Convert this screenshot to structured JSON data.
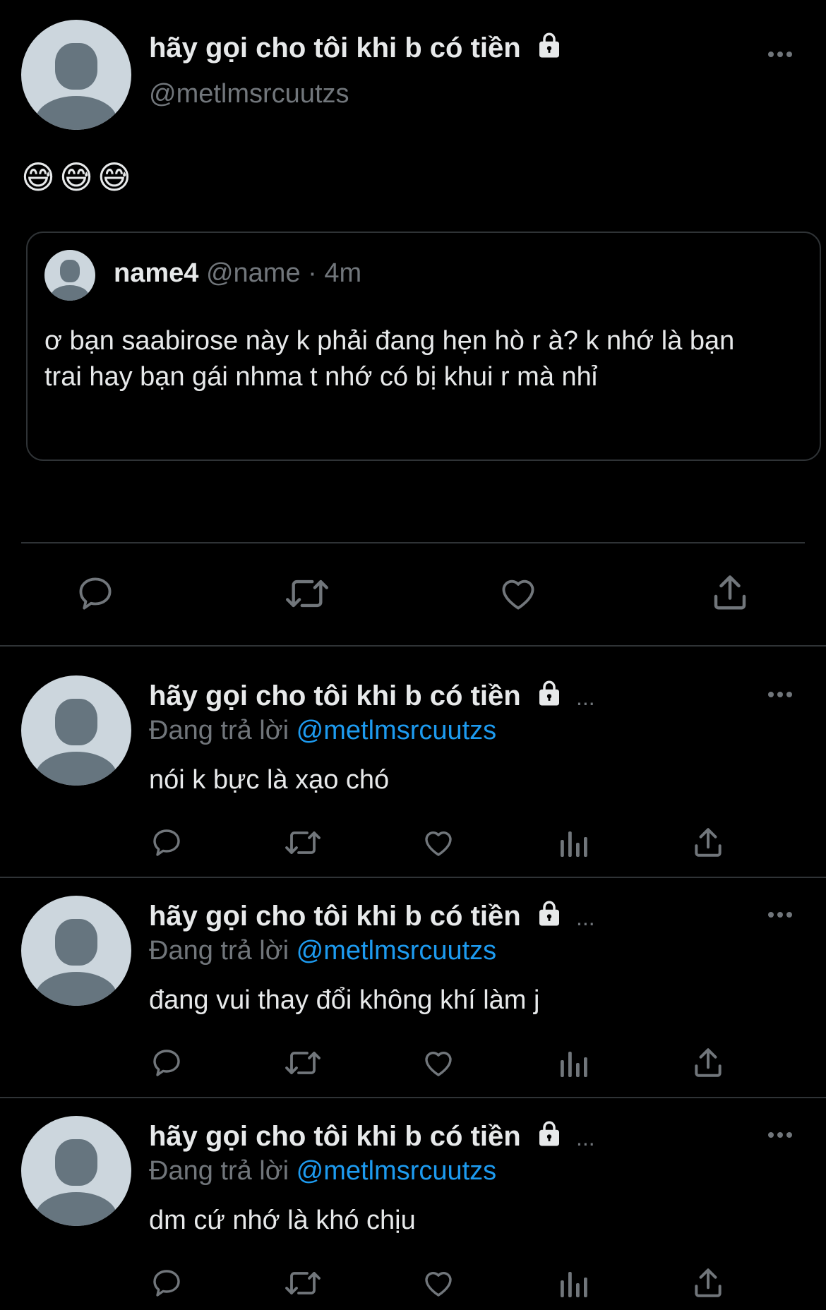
{
  "main_tweet": {
    "display_name": "hãy gọi cho tôi khi b có tiền",
    "handle": "@metlmsrcuutzs",
    "emojis": "😅😅😅",
    "quote": {
      "name": "name4",
      "handle": "@name",
      "time": "· 4m",
      "text": "ơ bạn saabirose này k phải đang hẹn hò r à? k nhớ là bạn trai hay bạn gái nhma t nhớ có bị khui r mà nhỉ"
    }
  },
  "replies": [
    {
      "display_name": "hãy gọi cho tôi khi b có tiền",
      "ellipsis": "...",
      "replying_label": "Đang trả lời",
      "replying_handle": "@metlmsrcuutzs",
      "text": "nói k bực là xạo chó"
    },
    {
      "display_name": "hãy gọi cho tôi khi b có tiền",
      "ellipsis": "...",
      "replying_label": "Đang trả lời",
      "replying_handle": "@metlmsrcuutzs",
      "text": "đang vui thay đổi không khí làm j"
    },
    {
      "display_name": "hãy gọi cho tôi khi b có tiền",
      "ellipsis": "...",
      "replying_label": "Đang trả lời",
      "replying_handle": "@metlmsrcuutzs",
      "text": "dm cứ nhớ là khó chịu"
    }
  ],
  "colors": {
    "background": "#000000",
    "text": "#e7e9ea",
    "secondary": "#71767b",
    "accent": "#1d9bf0",
    "avatar_bg": "#ccd6dd",
    "avatar_fg": "#66757f"
  },
  "icons": [
    "reply-icon",
    "retweet-icon",
    "like-icon",
    "views-icon",
    "share-icon",
    "lock-icon",
    "more-icon"
  ]
}
